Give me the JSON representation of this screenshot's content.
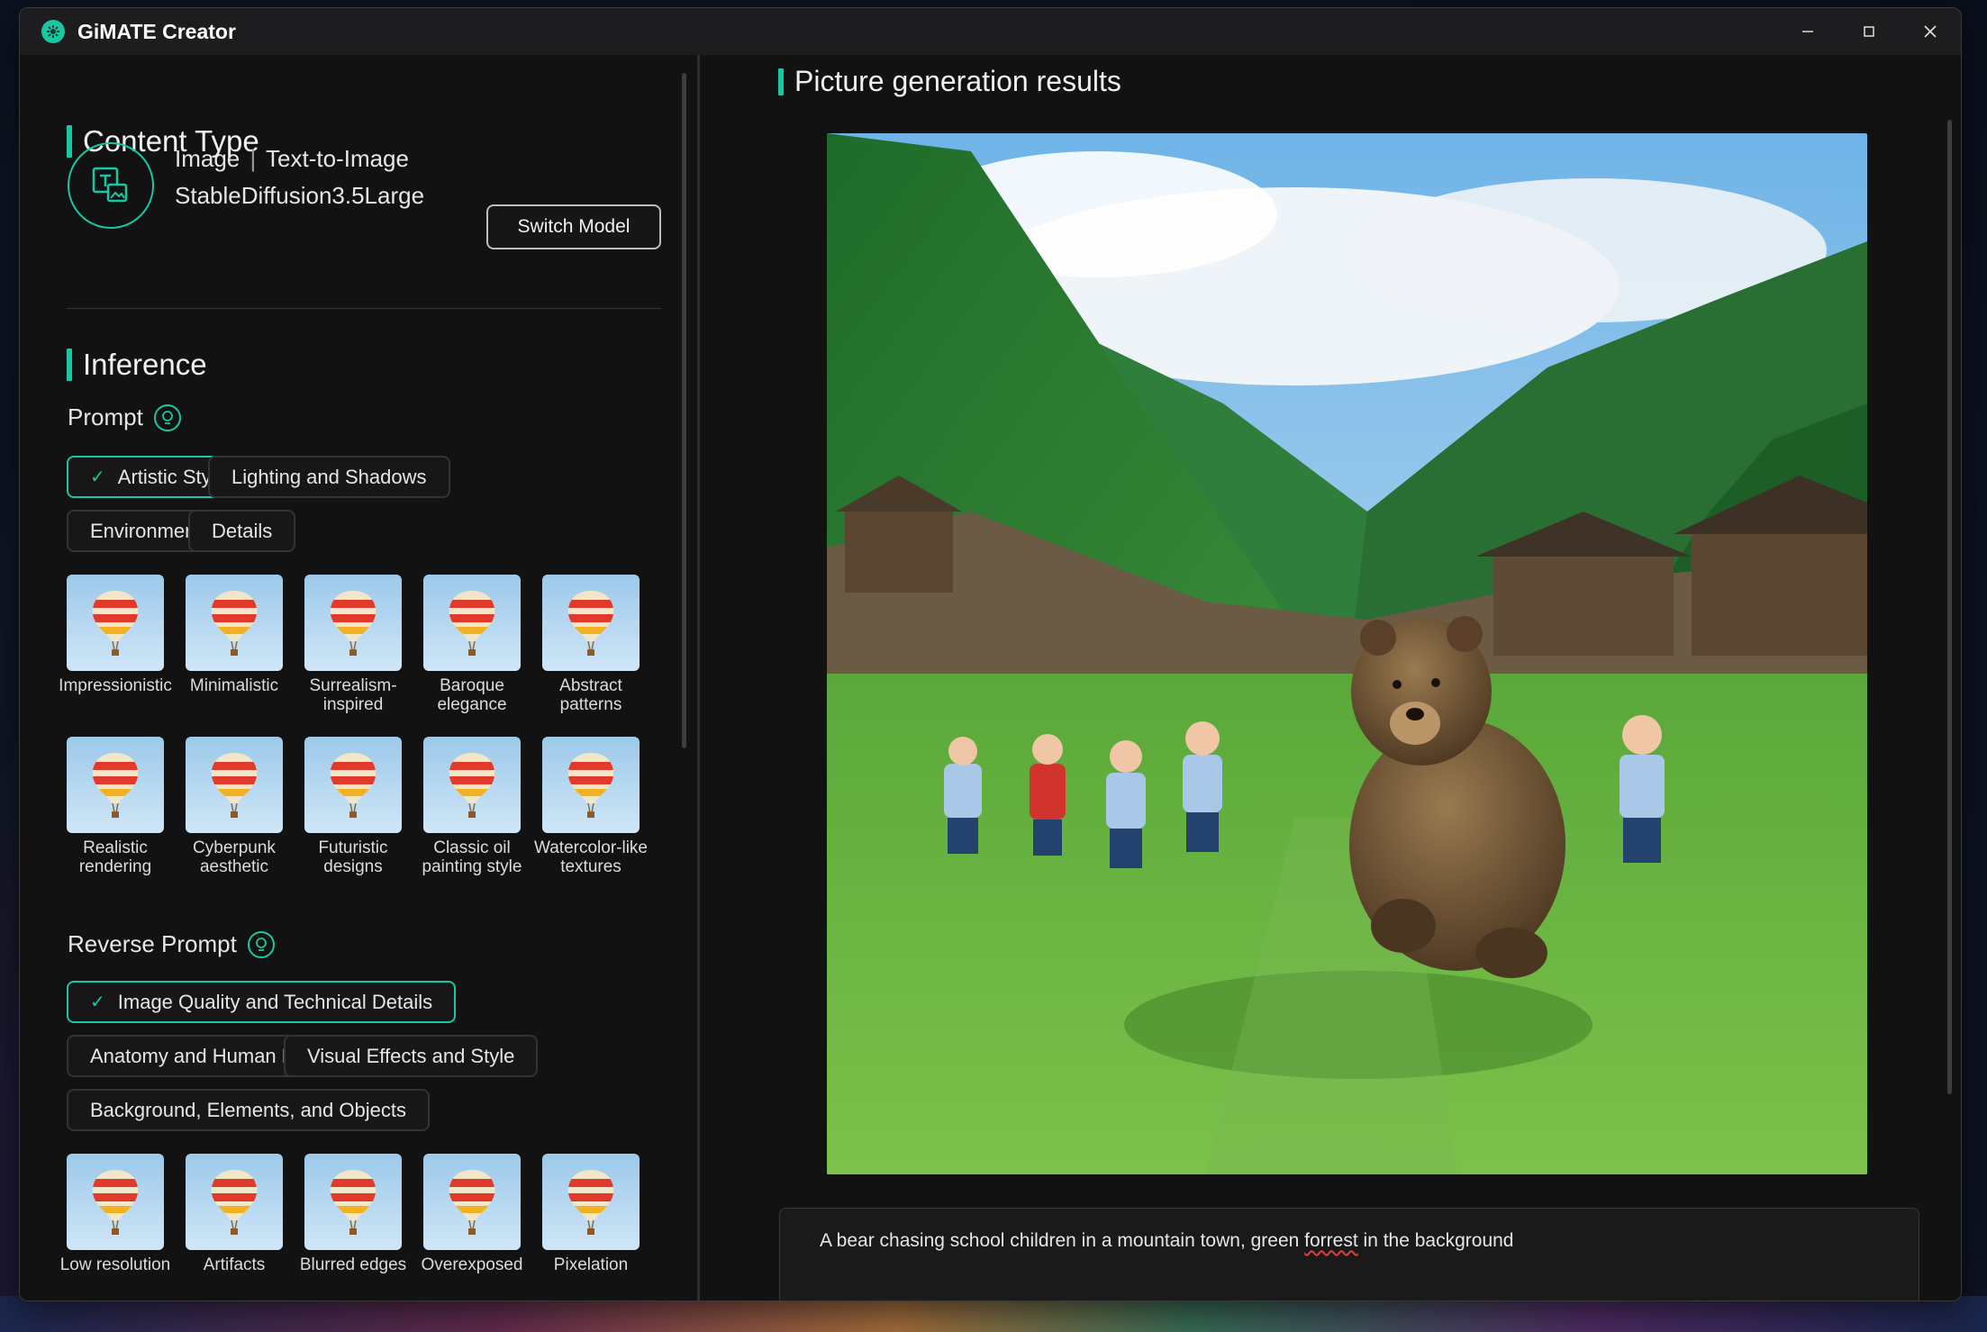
{
  "app": {
    "title": "GiMATE Creator"
  },
  "window_controls": {
    "minimize": "—",
    "maximize": "☐",
    "close": "✕"
  },
  "content_type": {
    "title": "Content Type",
    "type_line_part1": "Image",
    "type_separator": "|",
    "type_line_part2": "Text-to-Image",
    "model_name": "StableDiffusion3.5Large",
    "switch_label": "Switch Model"
  },
  "inference": {
    "title": "Inference",
    "prompt": {
      "label": "Prompt",
      "tabs": [
        {
          "label": "Artistic Style",
          "selected": true
        },
        {
          "label": "Lighting and Shadows",
          "selected": false
        },
        {
          "label": "Environment",
          "selected": false
        },
        {
          "label": "Details",
          "selected": false
        }
      ],
      "styles": [
        "Impressionistic",
        "Minimalistic",
        "Surrealism-inspired",
        "Baroque elegance",
        "Abstract patterns",
        "Realistic rendering",
        "Cyberpunk aesthetic",
        "Futuristic designs",
        "Classic oil painting style",
        "Watercolor-like textures"
      ]
    },
    "reverse_prompt": {
      "label": "Reverse Prompt",
      "tabs": [
        {
          "label": "Image Quality and Technical Details",
          "selected": true
        },
        {
          "label": "Anatomy and Human Details",
          "selected": false
        },
        {
          "label": "Visual Effects and Style",
          "selected": false
        },
        {
          "label": "Background, Elements, and Objects",
          "selected": false
        }
      ],
      "items": [
        "Low resolution",
        "Artifacts",
        "Blurred edges",
        "Overexposed",
        "Pixelation"
      ]
    }
  },
  "results": {
    "title": "Picture generation results",
    "prompt_before": "A bear chasing school children in a mountain town, green ",
    "prompt_typo": "forrest",
    "prompt_after": " in the background"
  },
  "icons": {
    "app_logo": "gimate-logo-icon",
    "model": "text-to-image-icon",
    "bulb": "lightbulb-icon",
    "check": "check-icon",
    "balloon": "hot-air-balloon-icon"
  },
  "colors": {
    "accent": "#17c8a2",
    "background": "#121212",
    "titlebar": "#1d1d1f"
  }
}
